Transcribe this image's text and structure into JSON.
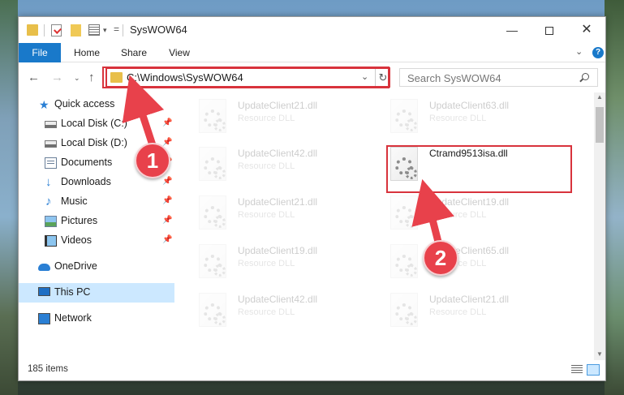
{
  "window": {
    "title": "SysWOW64",
    "minimize_glyph": "—",
    "close_glyph": "✕"
  },
  "quick_access_toolbar": {
    "icons": [
      "folder-icon",
      "properties-check-icon",
      "new-folder-icon",
      "properties-icon"
    ],
    "dropdown_glyph": "▾",
    "customize_glyph": "="
  },
  "ribbon": {
    "tabs": [
      "File",
      "Home",
      "Share",
      "View"
    ],
    "expand_glyph": "⌄",
    "help_glyph": "?"
  },
  "navigation": {
    "back_glyph": "←",
    "forward_glyph": "→",
    "recent_glyph": "⌄",
    "up_glyph": "↑"
  },
  "address_bar": {
    "path": "C:\\Windows\\SysWOW64",
    "dropdown_glyph": "⌄",
    "refresh_glyph": "↻"
  },
  "search": {
    "placeholder": "Search SysWOW64"
  },
  "nav_pane": {
    "pin_glyph": "📌",
    "items": [
      {
        "label": "Quick access",
        "icon": "star-icon",
        "pinned": false,
        "selected": false
      },
      {
        "label": "Local Disk (C:)",
        "icon": "drive-icon",
        "pinned": true,
        "selected": false
      },
      {
        "label": "Local Disk (D:)",
        "icon": "drive-icon",
        "pinned": true,
        "selected": false
      },
      {
        "label": "Documents",
        "icon": "documents-icon",
        "pinned": true,
        "selected": false
      },
      {
        "label": "Downloads",
        "icon": "downloads-icon",
        "pinned": true,
        "selected": false
      },
      {
        "label": "Music",
        "icon": "music-icon",
        "pinned": true,
        "selected": false
      },
      {
        "label": "Pictures",
        "icon": "pictures-icon",
        "pinned": true,
        "selected": false
      },
      {
        "label": "Videos",
        "icon": "videos-icon",
        "pinned": true,
        "selected": false
      },
      {
        "label": "OneDrive",
        "icon": "onedrive-icon",
        "pinned": false,
        "selected": false
      },
      {
        "label": "This PC",
        "icon": "this-pc-icon",
        "pinned": false,
        "selected": true
      },
      {
        "label": "Network",
        "icon": "network-icon",
        "pinned": false,
        "selected": false
      }
    ]
  },
  "files": [
    {
      "name": "UpdateClient21.dll",
      "type": "Resource DLL",
      "faded": true
    },
    {
      "name": "UpdateClient63.dll",
      "type": "Resource DLL",
      "faded": true
    },
    {
      "name": "UpdateClient42.dll",
      "type": "Resource DLL",
      "faded": true
    },
    {
      "name": "Ctramd9513isa.dll",
      "type": "",
      "faded": false
    },
    {
      "name": "UpdateClient21.dll",
      "type": "Resource DLL",
      "faded": true
    },
    {
      "name": "UpdateClient19.dll",
      "type": "Resource DLL",
      "faded": true
    },
    {
      "name": "UpdateClient19.dll",
      "type": "Resource DLL",
      "faded": true
    },
    {
      "name": "UpdateClient65.dll",
      "type": "Resource DLL",
      "faded": true
    },
    {
      "name": "UpdateClient42.dll",
      "type": "Resource DLL",
      "faded": true
    },
    {
      "name": "UpdateClient21.dll",
      "type": "Resource DLL",
      "faded": true
    }
  ],
  "status": {
    "item_count": "185 items"
  },
  "annotations": {
    "step1": "1",
    "step2": "2",
    "highlight_color": "#d8333c"
  },
  "colors": {
    "accent": "#1979ca",
    "selection": "#cce8ff",
    "annotation_red": "#e8414b"
  }
}
